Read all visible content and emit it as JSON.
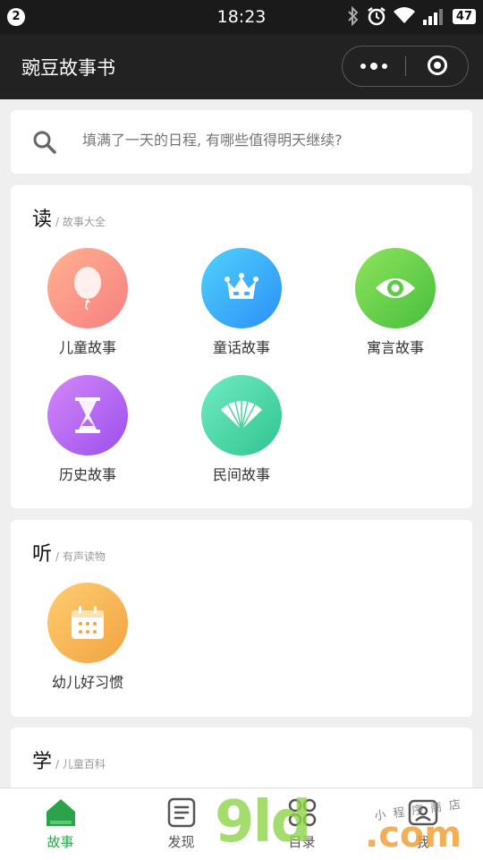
{
  "status_bar": {
    "notification_count": "2",
    "time": "18:23",
    "battery": "47"
  },
  "navbar": {
    "title": "豌豆故事书"
  },
  "search": {
    "placeholder": "填满了一天的日程, 有哪些值得明天继续?"
  },
  "sections": [
    {
      "title": "读",
      "subtitle": "/ 故事大全",
      "items": [
        {
          "label": "儿童故事",
          "icon": "balloon-icon",
          "color_from": "#ffb192",
          "color_to": "#f77f80"
        },
        {
          "label": "童话故事",
          "icon": "crown-icon",
          "color_from": "#4fd2fb",
          "color_to": "#2d8ff7"
        },
        {
          "label": "寓言故事",
          "icon": "eye-icon",
          "color_from": "#8fe35c",
          "color_to": "#46bf3e"
        },
        {
          "label": "历史故事",
          "icon": "hourglass-icon",
          "color_from": "#d487f8",
          "color_to": "#9b4fec"
        },
        {
          "label": "民间故事",
          "icon": "fan-icon",
          "color_from": "#72ebc4",
          "color_to": "#2fc48e"
        }
      ]
    },
    {
      "title": "听",
      "subtitle": "/ 有声读物",
      "items": [
        {
          "label": "幼儿好习惯",
          "icon": "calendar-icon",
          "color_from": "#ffcd72",
          "color_to": "#f1a33f"
        }
      ]
    },
    {
      "title": "学",
      "subtitle": "/ 儿童百科",
      "items": []
    }
  ],
  "tabbar": {
    "tabs": [
      {
        "label": "故事",
        "icon": "home-icon",
        "active": true
      },
      {
        "label": "发现",
        "icon": "document-icon",
        "active": false
      },
      {
        "label": "目录",
        "icon": "grid-icon",
        "active": false
      },
      {
        "label": "我",
        "icon": "profile-icon",
        "active": false
      }
    ],
    "active_color": "#2aa34a"
  },
  "watermark": {
    "main": "9ld",
    "tld": ".com",
    "tagline": "小程序商店"
  }
}
